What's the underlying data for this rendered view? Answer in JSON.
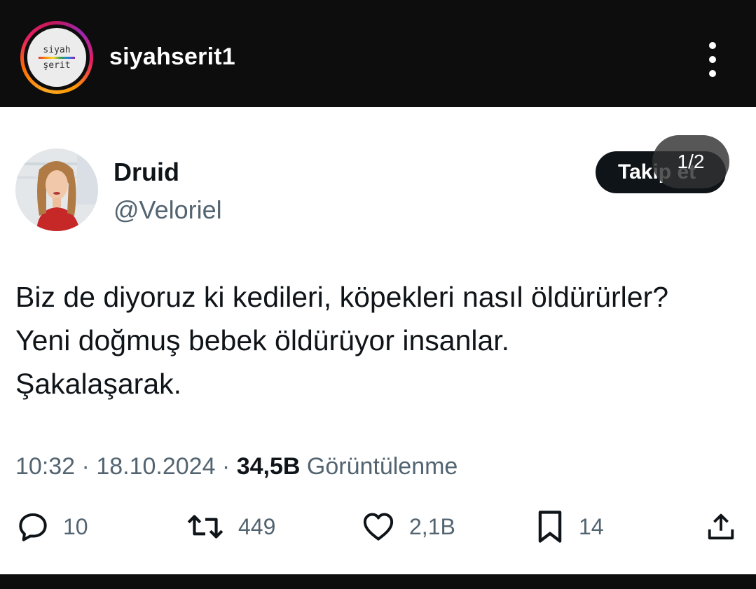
{
  "header": {
    "logo_line1": "siyah",
    "logo_line2": "şerit",
    "account_name": "siyahserit1"
  },
  "tweet": {
    "display_name": "Druid",
    "handle": "@Veloriel",
    "follow_label": "Takip et",
    "page_indicator": "1/2",
    "text_lines": [
      "Biz de diyoruz ki kedileri, köpekleri nasıl öldürürler?",
      "Yeni doğmuş bebek öldürüyor insanlar.",
      "Şakalaşarak."
    ],
    "time": "10:32",
    "date": "18.10.2024",
    "separator": " · ",
    "views_count": "34,5B",
    "views_label": "Görüntülenme"
  },
  "actions": {
    "replies": "10",
    "retweets": "449",
    "likes": "2,1B",
    "bookmarks": "14"
  },
  "colors": {
    "text_primary": "#0f1419",
    "text_secondary": "#536471",
    "topbar": "#0d0d0d"
  }
}
